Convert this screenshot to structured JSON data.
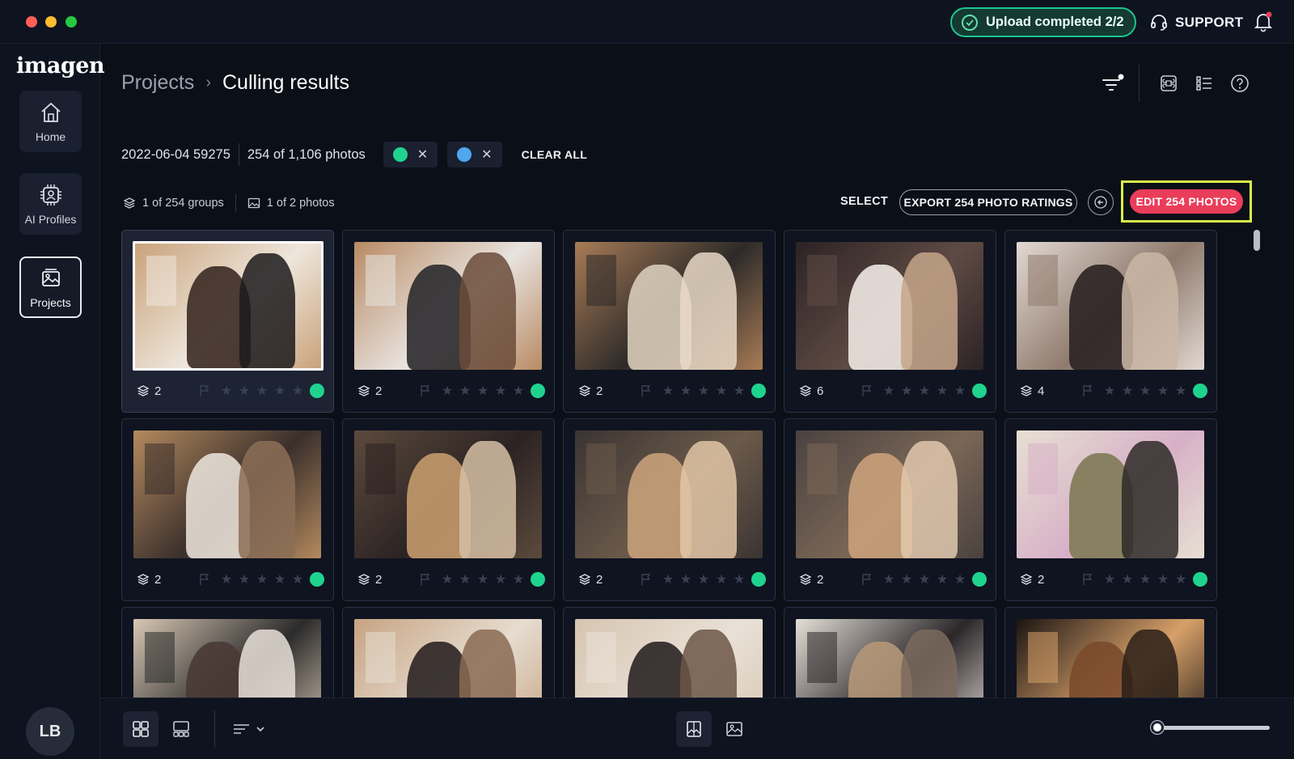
{
  "window": {
    "upload_status": "Upload completed 2/2",
    "support_label": "SUPPORT"
  },
  "sidebar": {
    "logo": "imagen",
    "items": [
      {
        "label": "Home",
        "icon": "home-icon"
      },
      {
        "label": "AI Profiles",
        "icon": "ai-chip-icon"
      },
      {
        "label": "Projects",
        "icon": "gallery-icon",
        "active": true
      }
    ],
    "avatar_initials": "LB"
  },
  "header": {
    "breadcrumb": [
      "Projects",
      "Culling results"
    ]
  },
  "filters": {
    "project_id": "2022-06-04 59275",
    "photo_count": "254 of 1,106 photos",
    "chips": [
      {
        "color": "#1fd38f",
        "remove": "✕"
      },
      {
        "color": "#4fa7ee",
        "remove": "✕"
      }
    ],
    "clear_all": "CLEAR ALL"
  },
  "actions": {
    "groups": "1 of 254 groups",
    "photos": "1 of 2 photos",
    "select": "SELECT",
    "export": "EXPORT 254 PHOTO RATINGS",
    "edit": "EDIT 254 PHOTOS"
  },
  "cards": [
    {
      "count": "2",
      "selected": true
    },
    {
      "count": "2"
    },
    {
      "count": "2"
    },
    {
      "count": "6"
    },
    {
      "count": "4"
    },
    {
      "count": "2"
    },
    {
      "count": "2"
    },
    {
      "count": "2"
    },
    {
      "count": "2"
    },
    {
      "count": "2"
    },
    {
      "count": ""
    },
    {
      "count": ""
    },
    {
      "count": ""
    },
    {
      "count": ""
    },
    {
      "count": ""
    }
  ],
  "colors": {
    "accent_green": "#1fd38f",
    "accent_blue": "#4fa7ee",
    "edit_button": "#ea3d5a",
    "highlight_frame": "#d9f04a"
  }
}
